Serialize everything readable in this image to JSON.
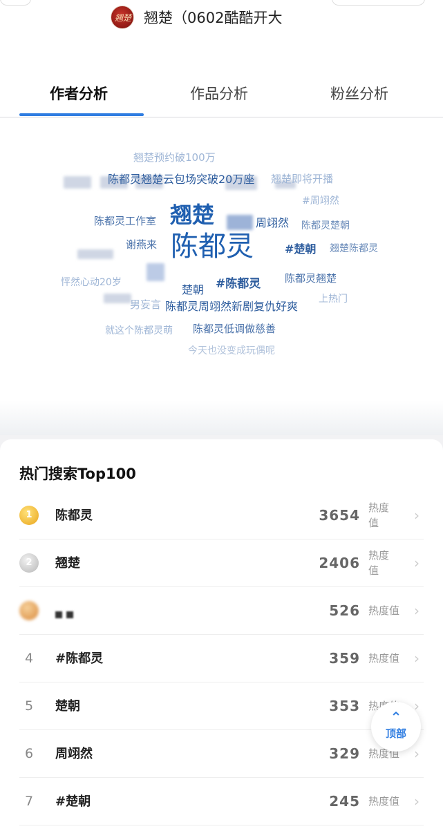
{
  "header": {
    "avatar_text": "翘楚",
    "account_name": "翘楚（0602酷酷开大"
  },
  "tabs": [
    {
      "label": "作者分析",
      "active": true
    },
    {
      "label": "作品分析",
      "active": false
    },
    {
      "label": "粉丝分析",
      "active": false
    }
  ],
  "word_cloud": {
    "words": [
      {
        "text": "翘楚预约破100万"
      },
      {
        "text": "陈都灵翘楚云包场突破20万座"
      },
      {
        "text": "翘楚即将开播"
      },
      {
        "text": "#周翊然"
      },
      {
        "text": "陈都灵工作室"
      },
      {
        "text": "翘楚"
      },
      {
        "text": "周翊然"
      },
      {
        "text": "陈都灵楚朝"
      },
      {
        "text": "谢燕来"
      },
      {
        "text": "陈都灵"
      },
      {
        "text": "#楚朝"
      },
      {
        "text": "翘楚陈都灵"
      },
      {
        "text": "怦然心动20岁"
      },
      {
        "text": "楚朝"
      },
      {
        "text": "#陈都灵"
      },
      {
        "text": "陈都灵翘楚"
      },
      {
        "text": "上热门"
      },
      {
        "text": "男妄言"
      },
      {
        "text": "陈都灵周翊然新剧复仇好爽"
      },
      {
        "text": "就这个陈都灵萌"
      },
      {
        "text": "陈都灵低调做慈善"
      },
      {
        "text": "今天也没变成玩偶呢"
      }
    ]
  },
  "hot_search": {
    "title": "热门搜索Top100",
    "rows": [
      {
        "rank": "1",
        "keyword": "陈都灵",
        "value": "3654",
        "unit": "热度值"
      },
      {
        "rank": "2",
        "keyword": "翘楚",
        "value": "2406",
        "unit": "热度值"
      },
      {
        "rank": "3",
        "keyword": "",
        "value": "526",
        "unit": "热度值"
      },
      {
        "rank": "4",
        "keyword": "#陈都灵",
        "value": "359",
        "unit": "热度值"
      },
      {
        "rank": "5",
        "keyword": "楚朝",
        "value": "353",
        "unit": "热度值"
      },
      {
        "rank": "6",
        "keyword": "周翊然",
        "value": "329",
        "unit": "热度值"
      },
      {
        "rank": "7",
        "keyword": "#楚朝",
        "value": "245",
        "unit": "热度值"
      }
    ]
  },
  "to_top": {
    "arrow": "⌃",
    "label": "顶部"
  },
  "icons": {
    "chevron": "›"
  },
  "colors": {
    "accent": "#2f7de1",
    "cloud_dark": "#1f5fb0",
    "cloud_light": "#9fb6d6"
  }
}
